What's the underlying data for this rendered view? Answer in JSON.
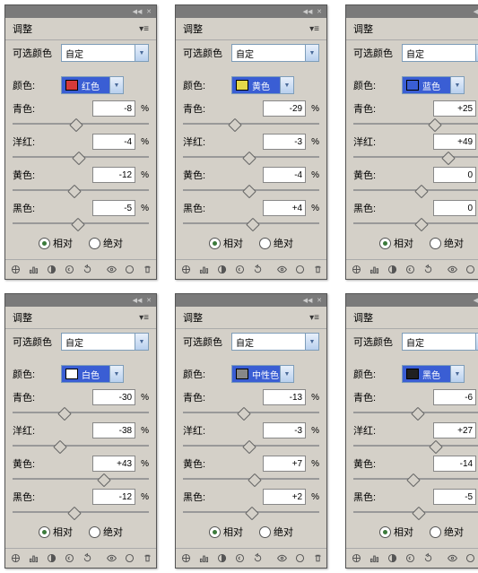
{
  "common": {
    "tab": "调整",
    "preset_label": "可选颜色",
    "preset_value": "自定",
    "color_label": "颜色:",
    "sliders": [
      "青色:",
      "洋红:",
      "黄色:",
      "黑色:"
    ],
    "pct": "%",
    "radio_rel": "相对",
    "radio_abs": "绝对"
  },
  "panels": [
    {
      "color_name": "红色",
      "swatch": "#d43a3a",
      "values": [
        -8,
        -4,
        -12,
        -5
      ]
    },
    {
      "color_name": "黄色",
      "swatch": "#e5d84a",
      "values": [
        -29,
        -3,
        -4,
        4
      ]
    },
    {
      "color_name": "蓝色",
      "swatch": "#3a5ed4",
      "values": [
        25,
        49,
        0,
        0
      ]
    },
    {
      "color_name": "白色",
      "swatch": "#ffffff",
      "values": [
        -30,
        -38,
        43,
        -12
      ]
    },
    {
      "color_name": "中性色",
      "swatch": "#888888",
      "values": [
        -13,
        -3,
        7,
        2
      ]
    },
    {
      "color_name": "黑色",
      "swatch": "#202020",
      "values": [
        -6,
        27,
        -14,
        -5
      ]
    }
  ]
}
